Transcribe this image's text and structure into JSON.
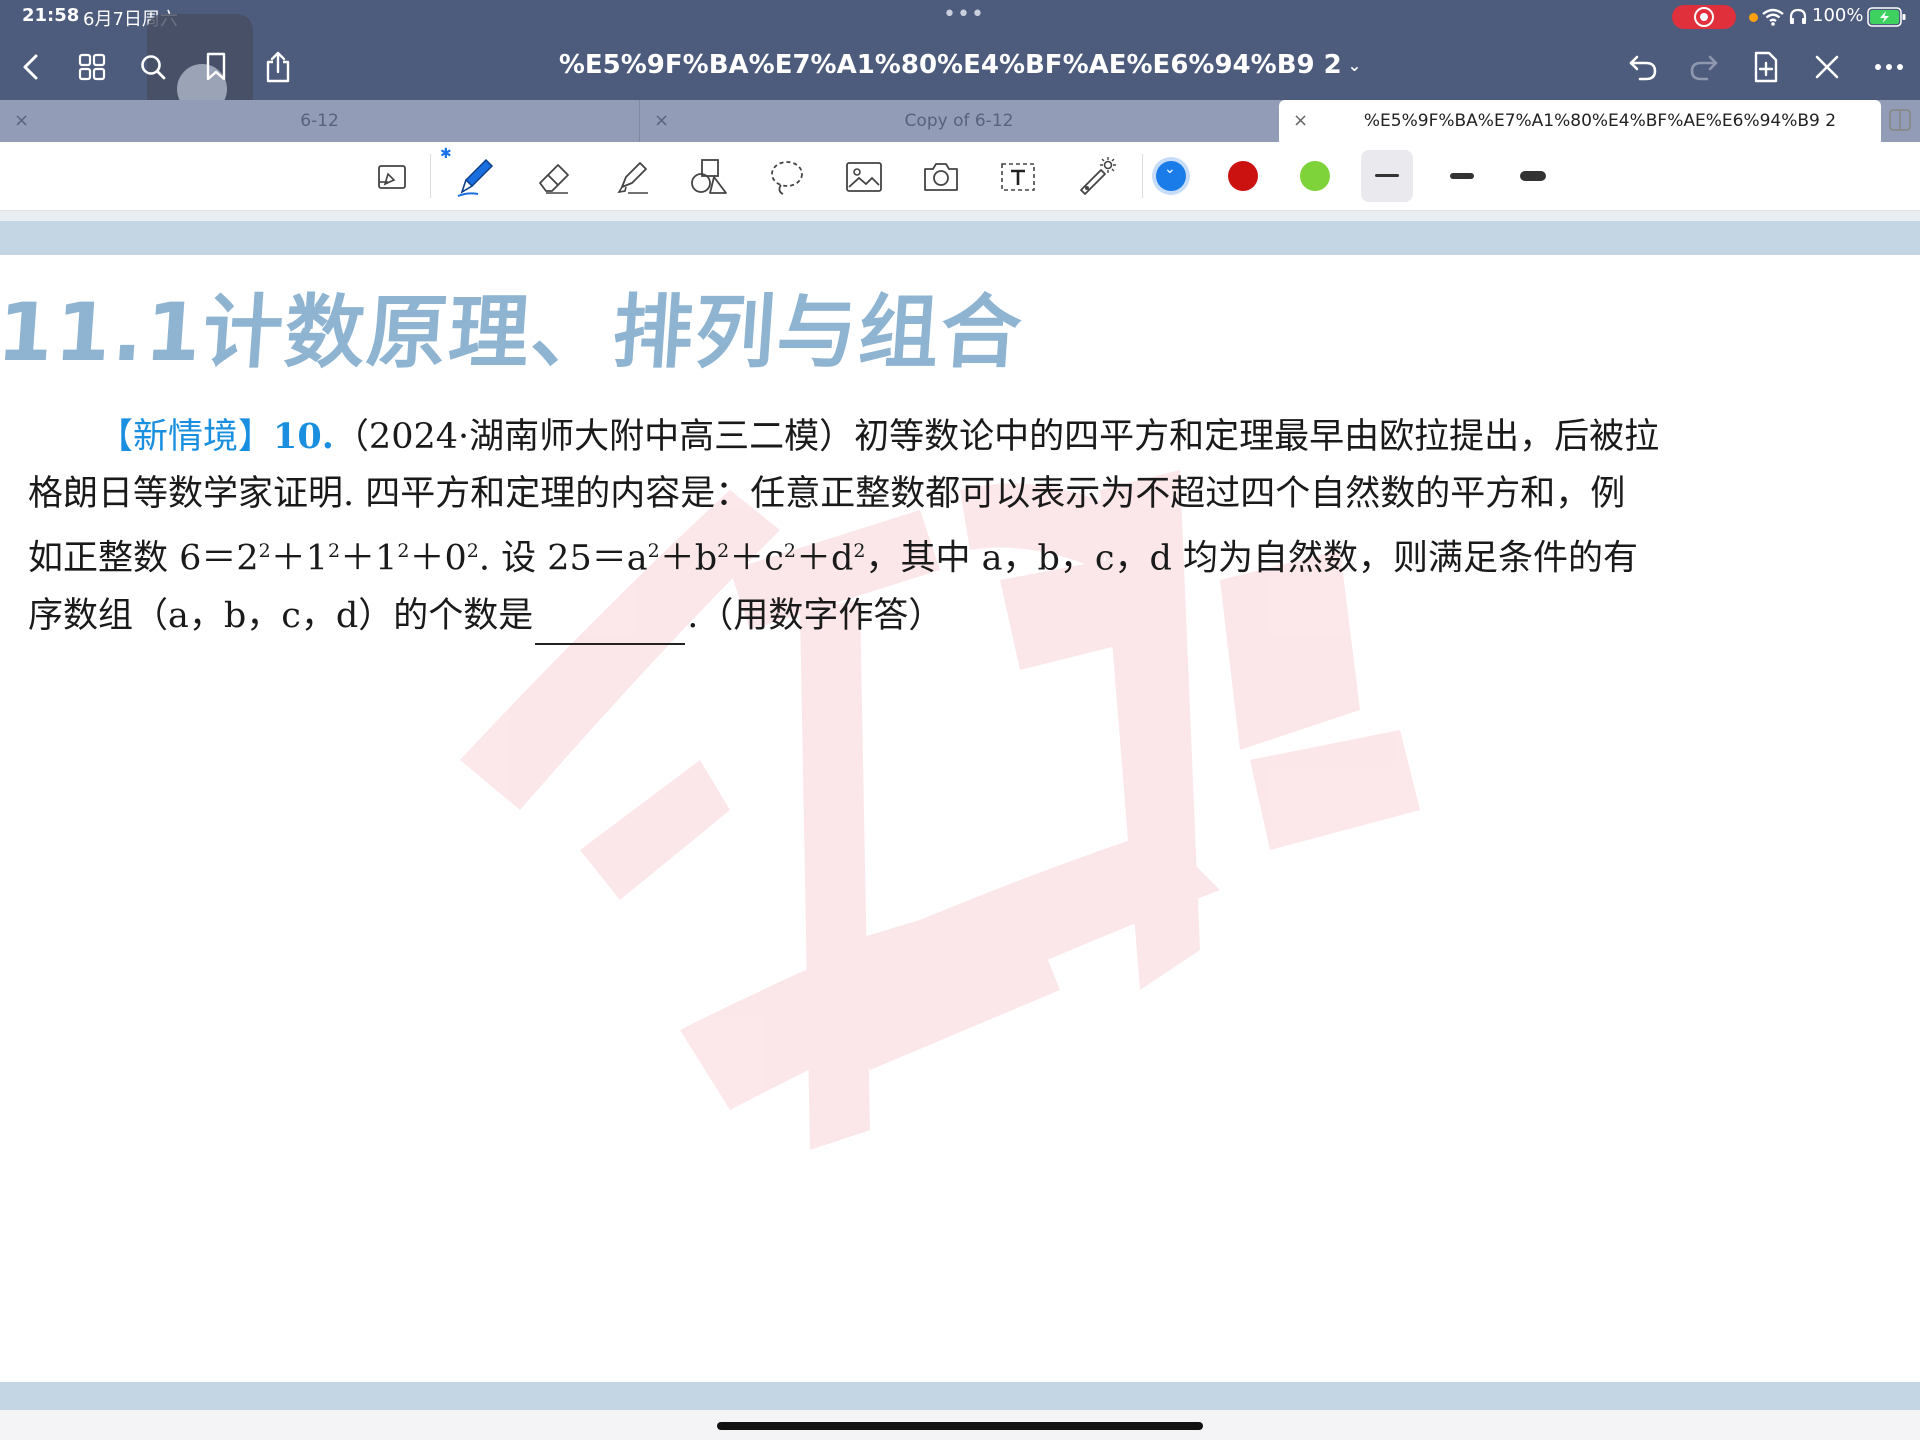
{
  "status": {
    "time": "21:58",
    "date": "6月7日周六",
    "battery": "100%"
  },
  "nav": {
    "title": "%E5%9F%BA%E7%A1%80%E4%BF%AE%E6%94%B9 2",
    "title_chevron": "⌄"
  },
  "tabs": [
    {
      "label": "6-12",
      "close": "×"
    },
    {
      "label": "Copy of 6-12",
      "close": "×"
    },
    {
      "label": "%E5%9F%BA%E7%A1%80%E4%BF%AE%E6%94%B9 2",
      "close": "×"
    }
  ],
  "toolbar": {
    "bluetooth": "✱",
    "colors": [
      "#1a7ce8",
      "#cc1111",
      "#7fd33a"
    ]
  },
  "document": {
    "heading": "11.1计数原理、排列与组合",
    "tag": "【新情境】",
    "number": "10.",
    "line1_text": "（2024·湖南师大附中高三二模）初等数论中的四平方和定理最早由欧拉提出，后被拉",
    "line2_text": "格朗日等数学家证明. 四平方和定理的内容是：任意正整数都可以表示为不超过四个自然数的平方和，例",
    "line3_a": "如正整数 6＝2",
    "line3_b": "＋1",
    "line3_c": "＋1",
    "line3_d": "＋0",
    "line3_e": ". 设 25＝a",
    "line3_f": "＋b",
    "line3_g": "＋c",
    "line3_h": "＋d",
    "line3_i": "，其中 a，b，c，d 均为自然数，则满足条件的有",
    "exp": "2",
    "line4_a": "序数组（a，b，c，d）的个数是",
    "line4_b": ".（用数字作答）"
  }
}
